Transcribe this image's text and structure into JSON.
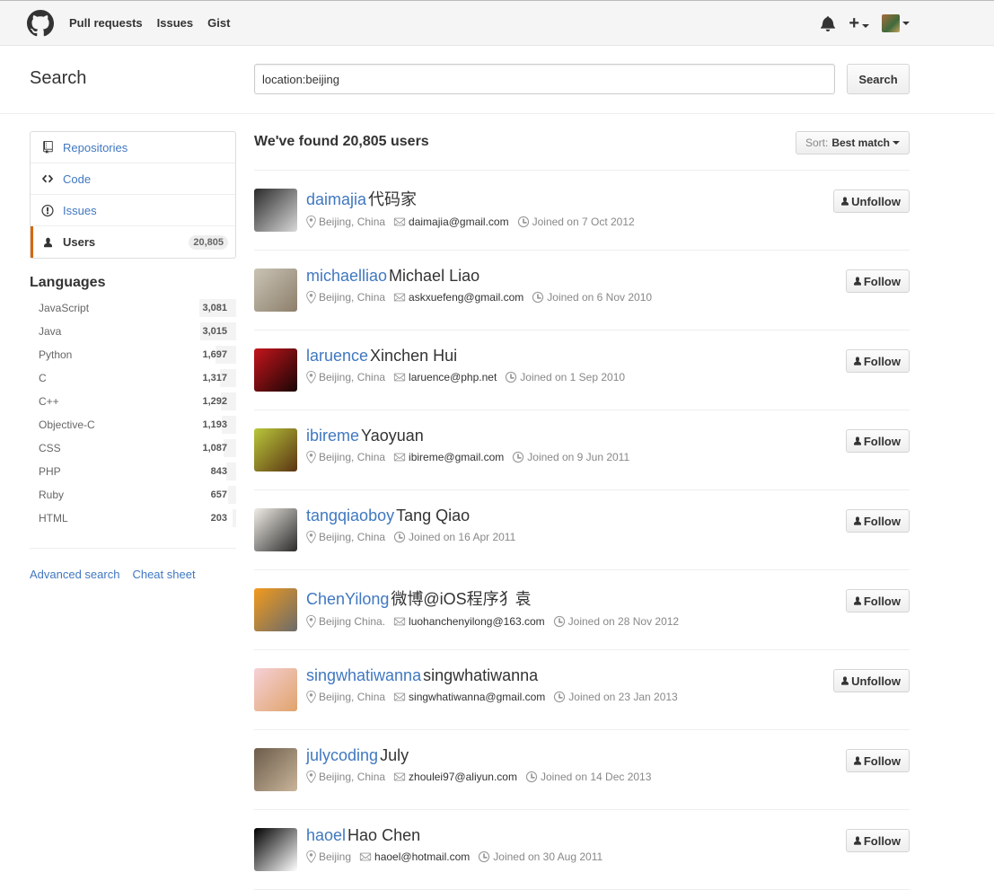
{
  "header": {
    "nav": [
      "Pull requests",
      "Issues",
      "Gist"
    ],
    "plus": "+"
  },
  "search": {
    "title": "Search",
    "query": "location:beijing",
    "button": "Search"
  },
  "sidebar": {
    "menu": [
      {
        "label": "Repositories",
        "icon": "repo-icon"
      },
      {
        "label": "Code",
        "icon": "code-icon"
      },
      {
        "label": "Issues",
        "icon": "issue-icon"
      },
      {
        "label": "Users",
        "icon": "person-icon",
        "count": "20,805",
        "selected": true
      }
    ],
    "languages_title": "Languages",
    "languages": [
      {
        "name": "JavaScript",
        "count": "3,081",
        "fraction": 1.0
      },
      {
        "name": "Java",
        "count": "3,015",
        "fraction": 0.98
      },
      {
        "name": "Python",
        "count": "1,697",
        "fraction": 0.55
      },
      {
        "name": "C",
        "count": "1,317",
        "fraction": 0.43
      },
      {
        "name": "C++",
        "count": "1,292",
        "fraction": 0.42
      },
      {
        "name": "Objective-C",
        "count": "1,193",
        "fraction": 0.39
      },
      {
        "name": "CSS",
        "count": "1,087",
        "fraction": 0.35
      },
      {
        "name": "PHP",
        "count": "843",
        "fraction": 0.27
      },
      {
        "name": "Ruby",
        "count": "657",
        "fraction": 0.21
      },
      {
        "name": "HTML",
        "count": "203",
        "fraction": 0.07
      }
    ],
    "links": [
      "Advanced search",
      "Cheat sheet"
    ]
  },
  "results": {
    "title": "We've found 20,805 users",
    "sort_label": "Sort:",
    "sort_value": "Best match",
    "users": [
      {
        "login": "daimajia",
        "name": "代码家",
        "location": "Beijing, China",
        "email": "daimajia@gmail.com",
        "joined": "Joined on 7 Oct 2012",
        "action": "Unfollow",
        "avatar_colors": [
          "#2a2a2a",
          "#d8d8d8"
        ]
      },
      {
        "login": "michaelliao",
        "name": "Michael Liao",
        "location": "Beijing, China",
        "email": "askxuefeng@gmail.com",
        "joined": "Joined on 6 Nov 2010",
        "action": "Follow",
        "avatar_colors": [
          "#c9c3b5",
          "#8d7f6b"
        ]
      },
      {
        "login": "laruence",
        "name": "Xinchen Hui",
        "location": "Beijing, China",
        "email": "laruence@php.net",
        "joined": "Joined on 1 Sep 2010",
        "action": "Follow",
        "avatar_colors": [
          "#c4151c",
          "#1a0505"
        ]
      },
      {
        "login": "ibireme",
        "name": "Yaoyuan",
        "location": "Beijing, China",
        "email": "ibireme@gmail.com",
        "joined": "Joined on 9 Jun 2011",
        "action": "Follow",
        "avatar_colors": [
          "#b9c73a",
          "#5a3413"
        ]
      },
      {
        "login": "tangqiaoboy",
        "name": "Tang Qiao",
        "location": "Beijing, China",
        "email": "",
        "joined": "Joined on 16 Apr 2011",
        "action": "Follow",
        "avatar_colors": [
          "#f1ece6",
          "#2b2b2b"
        ]
      },
      {
        "login": "ChenYilong",
        "name": "微博@iOS程序犭袁",
        "location": "Beijing China.",
        "email": "luohanchenyilong@163.com",
        "joined": "Joined on 28 Nov 2012",
        "action": "Follow",
        "avatar_colors": [
          "#f29b1c",
          "#6b6b6b"
        ]
      },
      {
        "login": "singwhatiwanna",
        "name": "singwhatiwanna",
        "location": "Beijing, China",
        "email": "singwhatiwanna@gmail.com",
        "joined": "Joined on 23 Jan 2013",
        "action": "Unfollow",
        "avatar_colors": [
          "#f5d0d6",
          "#e0a36b"
        ]
      },
      {
        "login": "julycoding",
        "name": "July",
        "location": "Beijing, China",
        "email": "zhoulei97@aliyun.com",
        "joined": "Joined on 14 Dec 2013",
        "action": "Follow",
        "avatar_colors": [
          "#6b5b4a",
          "#c9b59a"
        ]
      },
      {
        "login": "haoel",
        "name": "Hao Chen",
        "location": "Beijing",
        "email": "haoel@hotmail.com",
        "joined": "Joined on 30 Aug 2011",
        "action": "Follow",
        "avatar_colors": [
          "#000000",
          "#ffffff"
        ]
      }
    ]
  }
}
